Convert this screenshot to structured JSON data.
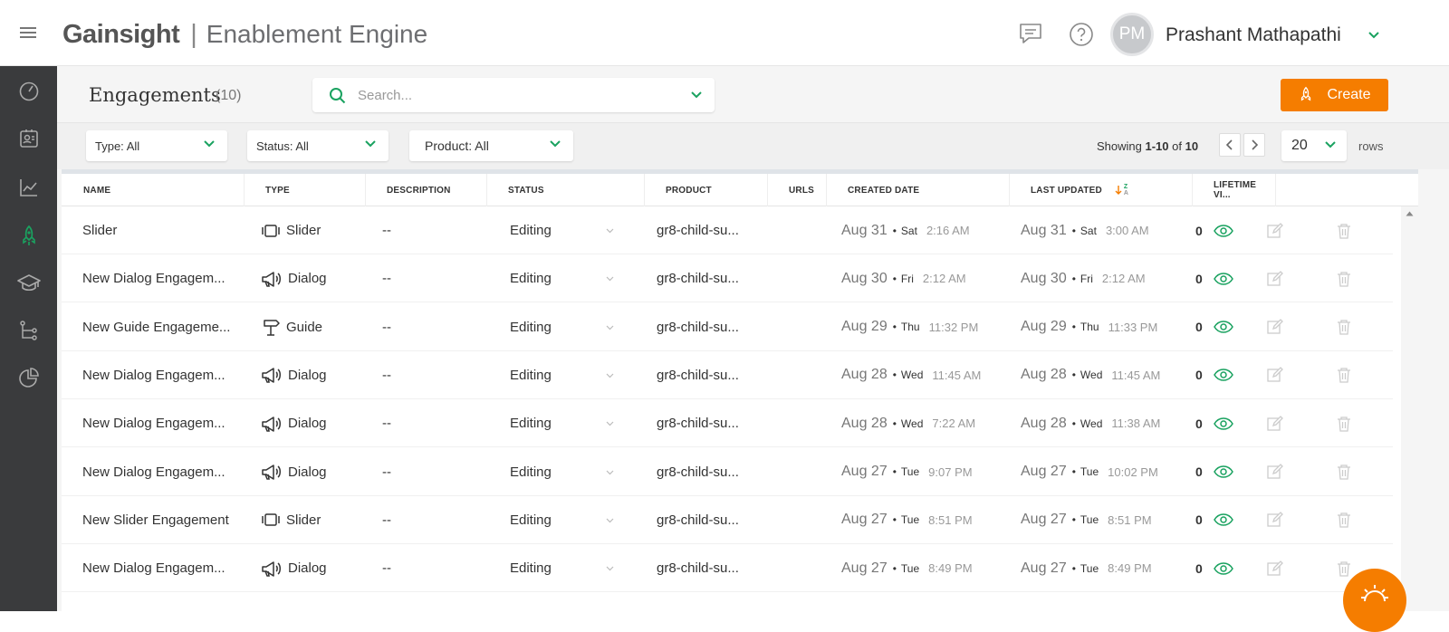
{
  "header": {
    "brand_logo": "Gainsight",
    "brand_separator": "|",
    "app_name": "Enablement Engine",
    "user_initials": "PM",
    "user_name": "Prashant Mathapathi"
  },
  "page": {
    "title": "Engagements",
    "count": "(10)",
    "search_placeholder": "Search...",
    "create_label": "Create"
  },
  "filters": {
    "type": "Type: All",
    "status": "Status: All",
    "product": "Product: All"
  },
  "pagination": {
    "showing_prefix": "Showing ",
    "showing_range": "1-10",
    "showing_of": " of ",
    "showing_total": "10",
    "rows_value": "20",
    "rows_label": "rows"
  },
  "table": {
    "columns": [
      "NAME",
      "TYPE",
      "DESCRIPTION",
      "STATUS",
      "PRODUCT",
      "URLS",
      "CREATED DATE",
      "LAST UPDATED",
      "LIFETIME VI..."
    ],
    "sort_icon_letters": [
      "Z",
      "A"
    ],
    "rows": [
      {
        "name": "Slider",
        "type": "Slider",
        "type_icon": "slider-icon",
        "description": "--",
        "status": "Editing",
        "product": "gr8-child-su...",
        "created": {
          "date": "Aug 31",
          "day": "Sat",
          "time": "2:16 AM"
        },
        "updated": {
          "date": "Aug 31",
          "day": "Sat",
          "time": "3:00 AM"
        },
        "views": "0"
      },
      {
        "name": "New Dialog Engagem...",
        "type": "Dialog",
        "type_icon": "megaphone-icon",
        "description": "--",
        "status": "Editing",
        "product": "gr8-child-su...",
        "created": {
          "date": "Aug 30",
          "day": "Fri",
          "time": "2:12 AM"
        },
        "updated": {
          "date": "Aug 30",
          "day": "Fri",
          "time": "2:12 AM"
        },
        "views": "0"
      },
      {
        "name": "New Guide Engageme...",
        "type": "Guide",
        "type_icon": "signpost-icon",
        "description": "--",
        "status": "Editing",
        "product": "gr8-child-su...",
        "created": {
          "date": "Aug 29",
          "day": "Thu",
          "time": "11:32 PM"
        },
        "updated": {
          "date": "Aug 29",
          "day": "Thu",
          "time": "11:33 PM"
        },
        "views": "0"
      },
      {
        "name": "New Dialog Engagem...",
        "type": "Dialog",
        "type_icon": "megaphone-icon",
        "description": "--",
        "status": "Editing",
        "product": "gr8-child-su...",
        "created": {
          "date": "Aug 28",
          "day": "Wed",
          "time": "11:45 AM"
        },
        "updated": {
          "date": "Aug 28",
          "day": "Wed",
          "time": "11:45 AM"
        },
        "views": "0"
      },
      {
        "name": "New Dialog Engagem...",
        "type": "Dialog",
        "type_icon": "megaphone-icon",
        "description": "--",
        "status": "Editing",
        "product": "gr8-child-su...",
        "created": {
          "date": "Aug 28",
          "day": "Wed",
          "time": "7:22 AM"
        },
        "updated": {
          "date": "Aug 28",
          "day": "Wed",
          "time": "11:38 AM"
        },
        "views": "0"
      },
      {
        "name": "New Dialog Engagem...",
        "type": "Dialog",
        "type_icon": "megaphone-icon",
        "description": "--",
        "status": "Editing",
        "product": "gr8-child-su...",
        "created": {
          "date": "Aug 27",
          "day": "Tue",
          "time": "9:07 PM"
        },
        "updated": {
          "date": "Aug 27",
          "day": "Tue",
          "time": "10:02 PM"
        },
        "views": "0"
      },
      {
        "name": "New Slider Engagement",
        "type": "Slider",
        "type_icon": "slider-icon",
        "description": "--",
        "status": "Editing",
        "product": "gr8-child-su...",
        "created": {
          "date": "Aug 27",
          "day": "Tue",
          "time": "8:51 PM"
        },
        "updated": {
          "date": "Aug 27",
          "day": "Tue",
          "time": "8:51 PM"
        },
        "views": "0"
      },
      {
        "name": "New Dialog Engagem...",
        "type": "Dialog",
        "type_icon": "megaphone-icon",
        "description": "--",
        "status": "Editing",
        "product": "gr8-child-su...",
        "created": {
          "date": "Aug 27",
          "day": "Tue",
          "time": "8:49 PM"
        },
        "updated": {
          "date": "Aug 27",
          "day": "Tue",
          "time": "8:49 PM"
        },
        "views": "0"
      }
    ]
  },
  "sidebar": {
    "items": [
      {
        "icon": "gauge-icon",
        "active": false
      },
      {
        "icon": "contact-card-icon",
        "active": false
      },
      {
        "icon": "analytics-chart-icon",
        "active": false
      },
      {
        "icon": "rocket-icon",
        "active": true
      },
      {
        "icon": "graduation-cap-icon",
        "active": false
      },
      {
        "icon": "flow-tree-icon",
        "active": false
      },
      {
        "icon": "pie-chart-icon",
        "active": false
      }
    ]
  },
  "colors": {
    "accent_orange": "#f57d00",
    "accent_green": "#1aa260",
    "sidebar_bg": "#3a3b3d",
    "brand_blue": "#1fa7e0"
  }
}
